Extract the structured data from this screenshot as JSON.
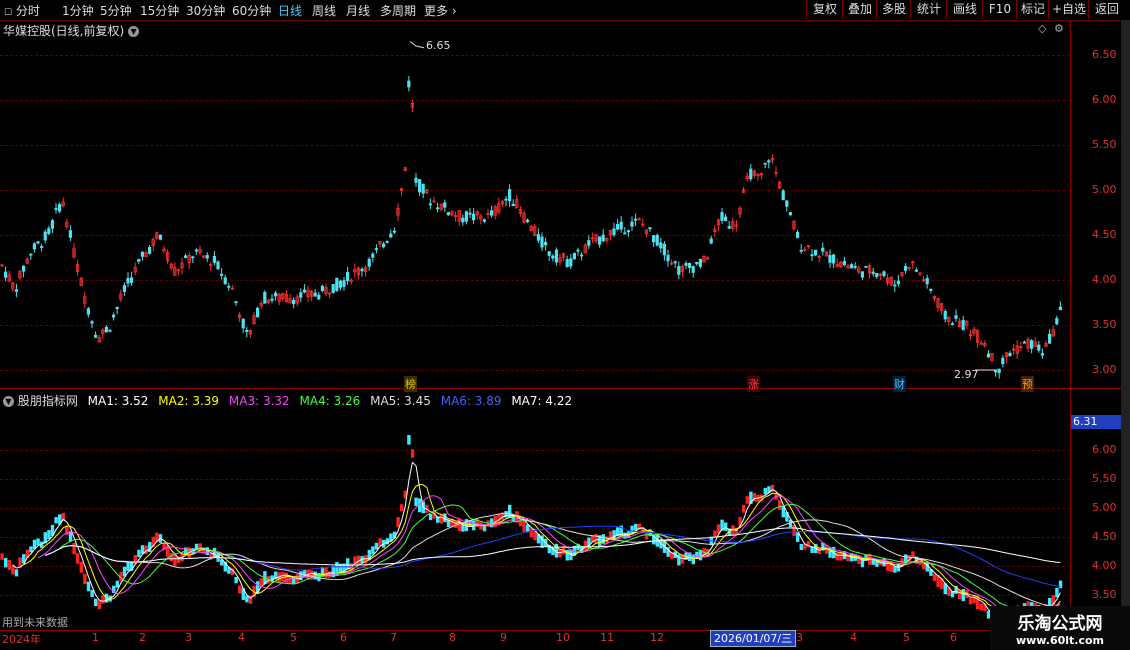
{
  "toolbar": {
    "tabs": [
      "分时",
      "1分钟",
      "5分钟",
      "15分钟",
      "30分钟",
      "60分钟",
      "日线",
      "周线",
      "月线",
      "多周期",
      "更多"
    ],
    "active_tab": "日线",
    "buttons": [
      "复权",
      "叠加",
      "多股",
      "统计",
      "画线",
      "F10",
      "标记",
      "+自选",
      "返回"
    ]
  },
  "main_panel": {
    "title": "华媒控股(日线,前复权)",
    "y_labels": [
      "6.50",
      "6.00",
      "5.50",
      "5.00",
      "4.50",
      "4.00",
      "3.50",
      "3.00"
    ],
    "high_label": "6.65",
    "low_label": "2.97",
    "markers": [
      {
        "text": "榜",
        "color": "#e8c000"
      },
      {
        "text": "涨",
        "color": "#ff4040"
      },
      {
        "text": "财",
        "color": "#4cc7ff"
      },
      {
        "text": "预",
        "color": "#ffa000"
      }
    ]
  },
  "indicator_panel": {
    "title": "股朋指标网",
    "ma": [
      {
        "label": "MA1: 3.52",
        "color": "#ffffff"
      },
      {
        "label": "MA2: 3.39",
        "color": "#ffff00"
      },
      {
        "label": "MA3: 3.32",
        "color": "#ff40ff"
      },
      {
        "label": "MA4: 3.26",
        "color": "#40ff40"
      },
      {
        "label": "MA5: 3.45",
        "color": "#dddddd"
      },
      {
        "label": "MA6: 3.89",
        "color": "#4060ff"
      },
      {
        "label": "MA7: 4.22",
        "color": "#ffffff"
      }
    ],
    "y_labels": [
      "6.00",
      "5.50",
      "5.00",
      "4.50",
      "4.00",
      "3.50"
    ],
    "current_price": "6.31",
    "footer_note": "用到未来数据"
  },
  "x_axis": {
    "labels": [
      "2024年",
      "1",
      "2",
      "3",
      "4",
      "5",
      "6",
      "7",
      "8",
      "9",
      "10",
      "11",
      "12",
      "2026/01/07/三",
      "3",
      "4",
      "5",
      "6"
    ],
    "selected_date": "2026/01/07/三"
  },
  "watermark": {
    "line1": "乐淘公式网",
    "line2": "www.60lt.com"
  },
  "colors": {
    "up": "#ff3030",
    "down": "#50e0f0",
    "axis": "#e03030"
  }
}
